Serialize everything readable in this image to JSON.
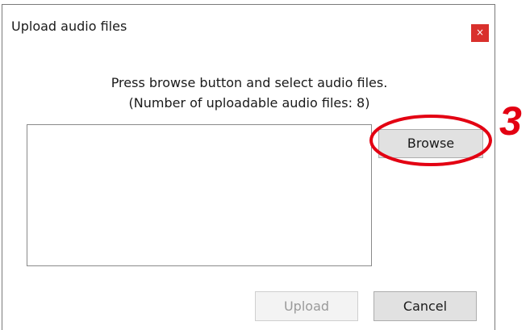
{
  "dialog": {
    "title": "Upload audio files",
    "close_label": "×",
    "instruction_line1": "Press browse button and select audio files.",
    "instruction_line2": "(Number of uploadable audio files: 8)",
    "file_list": []
  },
  "buttons": {
    "browse_label": "Browse",
    "upload_label": "Upload",
    "cancel_label": "Cancel",
    "upload_enabled": false
  },
  "annotation": {
    "step_number": "3",
    "color": "#e30012"
  },
  "colors": {
    "close_button": "#d9302c",
    "button_face": "#e1e1e1"
  }
}
